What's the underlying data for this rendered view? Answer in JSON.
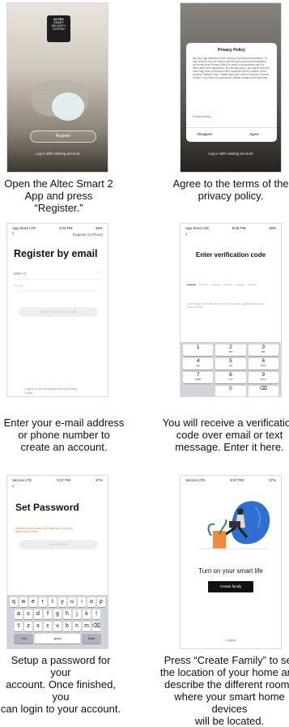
{
  "captions": {
    "step1": "Open the Altec Smart 2\nApp and press “Register.”",
    "step2": "Agree to the terms of the\nprivacy policy.",
    "step3": "Enter your e-mail address\nor phone number to\ncreate an account.",
    "step4": "You will receive a verification\ncode over email or text\nmessage. Enter it here.",
    "step5": "Setup a password for your\naccount.  Once finished, you\ncan login to your account.",
    "step6": "Press “Create Family” to set\nthe location of your home and\ndescribe the different rooms\nwhere your smart home devices\nwill be located."
  },
  "screen1": {
    "logo_brand": "ALTEC",
    "logo_l1": "SMART",
    "logo_l2": "SECURITY",
    "logo_l3": "SYSTEM",
    "register": "Register",
    "login": "Log in with existing account"
  },
  "screen2": {
    "dialog_title": "Privacy Policy",
    "body": "We pay high attention to the privacy of personal information. To fully present how we collect and use your personal information, we revised the Privacy Policy in detail in accordance with the latest laws and regulations. By clicking Agree, you agree that you have fully read, understood and accepted all the content of the revised Privacy Policy. Please take your time to read the Privacy Policy. If you have any questions, please contact us at any time.",
    "link": "Privacy Policy",
    "disagree": "Disagree",
    "agree": "Agree",
    "login": "Log in with existing account"
  },
  "screen3": {
    "status_left": "App Store  LTE",
    "status_mid": "4:24 PM",
    "status_right": "38%",
    "register_by_phone": "Register by Phone",
    "title": "Register by email",
    "country": "USA +1",
    "email_placeholder": "Email",
    "get_code": "Obtain verification code",
    "agree_text": "I agree to Service Agreement and Privacy\nPolicy"
  },
  "screen4": {
    "status_left": "App Store  LTE",
    "status_mid": "9:06 PM",
    "status_right": "39%",
    "title": "Enter verification code",
    "hint": "A verification code has been sent to your email: g.j@altecsmart.com. Resend (53s)",
    "keys": [
      {
        "n": "1",
        "s": ""
      },
      {
        "n": "2",
        "s": "ABC"
      },
      {
        "n": "3",
        "s": "DEF"
      },
      {
        "n": "4",
        "s": "GHI"
      },
      {
        "n": "5",
        "s": "JKL"
      },
      {
        "n": "6",
        "s": "MNO"
      },
      {
        "n": "7",
        "s": "PQRS"
      },
      {
        "n": "8",
        "s": "TUV"
      },
      {
        "n": "9",
        "s": "WXYZ"
      },
      {
        "n": "",
        "s": ""
      },
      {
        "n": "0",
        "s": ""
      },
      {
        "n": "⌫",
        "s": ""
      }
    ]
  },
  "screen5": {
    "status_left": "Verizon  LTE",
    "status_mid": "9:27 PM",
    "status_right": "37%",
    "title": "Set Password",
    "rule": "Password must contain 6-20 characters, including\nletters and numbers",
    "done": "Completed",
    "row1": [
      "q",
      "w",
      "e",
      "r",
      "t",
      "y",
      "u",
      "i",
      "o",
      "p"
    ],
    "row2": [
      "a",
      "s",
      "d",
      "f",
      "g",
      "h",
      "j",
      "k",
      "l"
    ],
    "row3": [
      "⇧",
      "z",
      "x",
      "c",
      "v",
      "b",
      "n",
      "m",
      "⌫"
    ],
    "key_123": ".?123",
    "key_space": "space",
    "key_done": "Done"
  },
  "screen6": {
    "status_left": "Verizon  LTE",
    "status_mid": "9:37 PM",
    "status_right": "37%",
    "heading": "Turn on your smart life",
    "create_family": "Create family",
    "logout": "Logout"
  }
}
